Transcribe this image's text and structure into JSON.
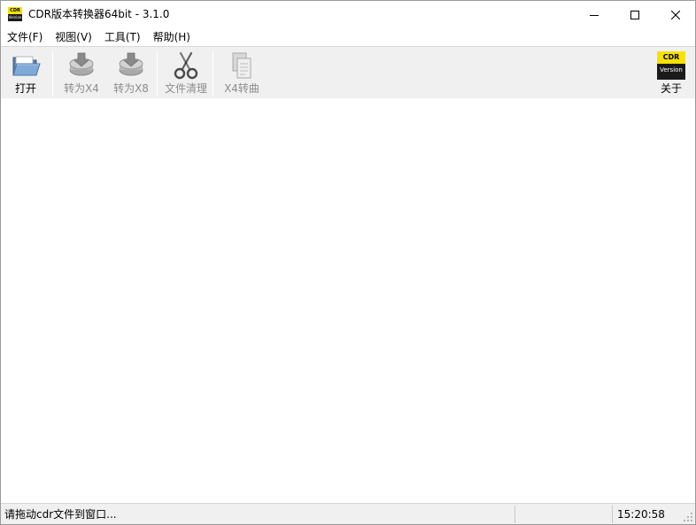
{
  "window": {
    "title": "CDR版本转换器64bit - 3.1.0",
    "icon": {
      "name": "cdr-version-app-icon",
      "top_text": "CDR",
      "bottom_text": "Version"
    },
    "controls": [
      "minimize-icon",
      "maximize-icon",
      "close-icon"
    ]
  },
  "menu": {
    "items": [
      {
        "label": "文件(F)"
      },
      {
        "label": "视图(V)"
      },
      {
        "label": "工具(T)"
      },
      {
        "label": "帮助(H)"
      }
    ]
  },
  "toolbar": {
    "open": {
      "label": "打开",
      "icon": "open-folder-icon",
      "enabled": true
    },
    "to_x4": {
      "label": "转为X4",
      "icon": "convert-disk-icon",
      "enabled": false
    },
    "to_x8": {
      "label": "转为X8",
      "icon": "convert-disk-icon",
      "enabled": false
    },
    "clean": {
      "label": "文件清理",
      "icon": "scissors-icon",
      "enabled": false
    },
    "x4_curve": {
      "label": "X4转曲",
      "icon": "copy-pages-icon",
      "enabled": false
    },
    "about": {
      "label": "关于",
      "icon": "cdr-version-icon",
      "icon_top_text": "CDR",
      "icon_bottom_text": "Version",
      "enabled": true
    }
  },
  "statusbar": {
    "message": "请拖动cdr文件到窗口...",
    "time": "15:20:58"
  },
  "colors": {
    "accent_yellow": "#f7e100",
    "toolbar_bg": "#f0f0f0",
    "disabled_text": "#8c8c8c"
  }
}
